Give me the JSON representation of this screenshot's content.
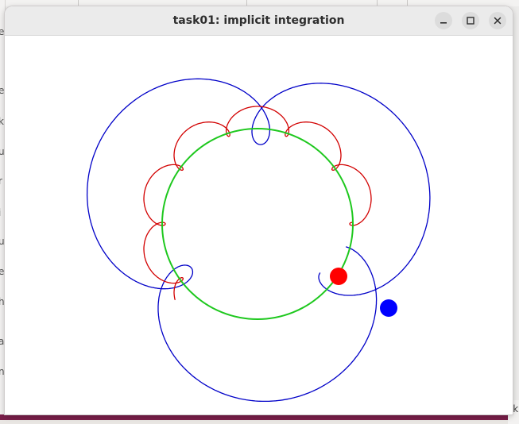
{
  "window": {
    "title": "task01: implicit integration",
    "minimize_icon": "minimize-icon",
    "maximize_icon": "maximize-icon",
    "close_icon": "close-icon"
  },
  "background": {
    "left_fragments": [
      "e",
      "e",
      "k",
      "u",
      "r",
      "i",
      "u",
      "e",
      "h",
      "a",
      "n"
    ],
    "bottom_right_fragment": "sk"
  },
  "scene": {
    "colors": {
      "ring": "#1ec81e",
      "trail_blue": "#0000c8",
      "trail_red": "#d20000",
      "ball_blue": "#0000ff",
      "ball_red": "#ff0000"
    }
  }
}
